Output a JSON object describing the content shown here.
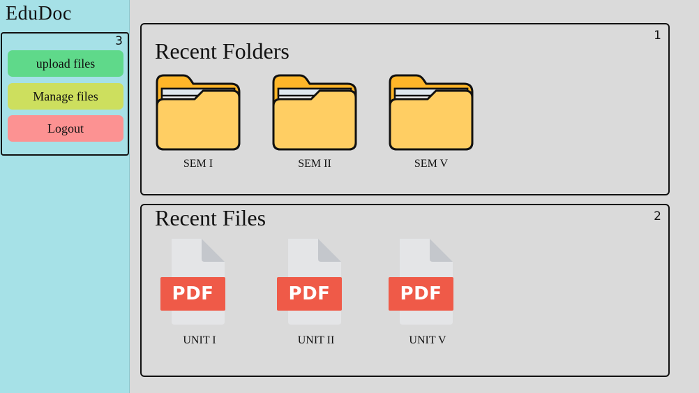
{
  "app": {
    "title": "EduDoc"
  },
  "sidebar": {
    "section_number": "3",
    "buttons": [
      {
        "label": "upload files"
      },
      {
        "label": "Manage files"
      },
      {
        "label": "Logout"
      }
    ]
  },
  "recent_folders": {
    "number": "1",
    "title": "Recent Folders",
    "items": [
      {
        "name": "SEM I",
        "icon": "folder-icon"
      },
      {
        "name": "SEM II",
        "icon": "folder-icon"
      },
      {
        "name": "SEM V",
        "icon": "folder-icon"
      }
    ]
  },
  "recent_files": {
    "number": "2",
    "title": "Recent Files",
    "items": [
      {
        "name": "UNIT I",
        "type": "PDF",
        "icon": "pdf-file-icon"
      },
      {
        "name": "UNIT II",
        "type": "PDF",
        "icon": "pdf-file-icon"
      },
      {
        "name": "UNIT V",
        "type": "PDF",
        "icon": "pdf-file-icon"
      }
    ]
  },
  "colors": {
    "sidebar_bg": "#a6e1e7",
    "main_bg": "#dadada",
    "upload_btn": "#5fd98a",
    "manage_btn": "#cddf5e",
    "logout_btn": "#fc9292",
    "folder_fill": "#ffce63",
    "folder_tab": "#ffb629",
    "pdf_label": "#ef5a48",
    "file_page": "#e4e5e7"
  }
}
